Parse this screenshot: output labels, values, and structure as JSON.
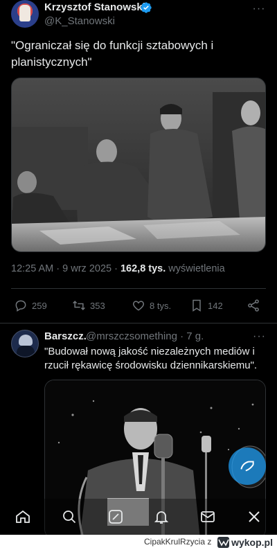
{
  "main_tweet": {
    "author_name": "Krzysztof Stanowski",
    "handle": "@K_Stanowski",
    "text": "\"Ograniczał się do funkcji sztabowych i planistycznych\"",
    "time": "12:25 AM · 9 wrz 2025 · ",
    "views_count": "162,8 tys.",
    "views_label": " wyświetlenia",
    "more_icon": "more-icon"
  },
  "actions": {
    "replies": "259",
    "retweets": "353",
    "likes": "8 tys.",
    "bookmarks": "142"
  },
  "reply_tweet": {
    "author_name": "Barszcz.",
    "handle": "@mrszczsomething · 7 g.",
    "text": "\"Budował nową jakość niezależnych mediów i rzucił rękawicę środowisku dziennikarskiemu\"."
  },
  "nav": {
    "items": [
      "home-icon",
      "search-icon",
      "grok-icon",
      "notifications-icon",
      "messages-icon",
      "communities-icon"
    ]
  },
  "footer": {
    "credit": "CipakKrulRzycia",
    "z": "z",
    "site": "wykop.pl"
  },
  "colors": {
    "accent": "#1d9bf0",
    "muted": "#71767b",
    "text": "#e7e9ea",
    "border": "#2f3336"
  }
}
